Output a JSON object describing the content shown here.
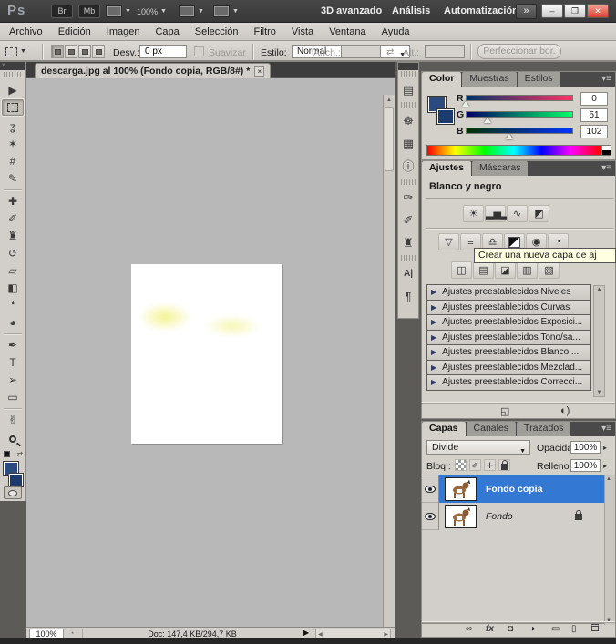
{
  "titlebar": {
    "logo": "Ps",
    "buttons": [
      "Br",
      "Mb"
    ],
    "zoom": "100%",
    "workspaces": [
      "3D avanzado",
      "Análisis",
      "Automatización"
    ],
    "more": "»",
    "window_buttons": [
      "–",
      "❐",
      "✕"
    ]
  },
  "menubar": {
    "items": [
      "Archivo",
      "Edición",
      "Imagen",
      "Capa",
      "Selección",
      "Filtro",
      "Vista",
      "Ventana",
      "Ayuda"
    ]
  },
  "optionsbar": {
    "feather_label": "Desv.:",
    "feather_value": "0 px",
    "antialias_label": "Suavizar",
    "style_label": "Estilo:",
    "style_value": "Normal",
    "width_label": "Anch.:",
    "swap_icon": "⇄",
    "height_label": "Alt.:",
    "refine_button": "Perfeccionar bor."
  },
  "toolbar": {
    "collapse": "»",
    "tools": [
      {
        "name": "move",
        "glyph": "▶"
      },
      {
        "name": "lasso",
        "glyph": "ʓ"
      },
      {
        "name": "quick-selection",
        "glyph": "✶"
      },
      {
        "name": "crop",
        "glyph": "#"
      },
      {
        "name": "eyedropper",
        "glyph": "✎"
      },
      {
        "name": "spot-healing",
        "glyph": "✚"
      },
      {
        "name": "brush",
        "glyph": "✐"
      },
      {
        "name": "clone-stamp",
        "glyph": "♜"
      },
      {
        "name": "history-brush",
        "glyph": "↺"
      },
      {
        "name": "eraser",
        "glyph": "▱"
      },
      {
        "name": "gradient",
        "glyph": "◧"
      },
      {
        "name": "blur",
        "glyph": "❛"
      },
      {
        "name": "dodge-burn",
        "glyph": "◕"
      },
      {
        "name": "pen",
        "glyph": "✒"
      },
      {
        "name": "type",
        "glyph": "T"
      },
      {
        "name": "path-selection",
        "glyph": "➢"
      },
      {
        "name": "shape",
        "glyph": "▭"
      },
      {
        "name": "hand",
        "glyph": "✌"
      }
    ]
  },
  "document": {
    "tab": "descarga.jpg al 100% (Fondo copia, RGB/8#) *",
    "close": "×",
    "status_zoom": "100%",
    "status_doc": "Doc: 147,4 KB/294,7 KB"
  },
  "icon_dock": [
    {
      "name": "history",
      "glyph": "▤"
    },
    {
      "name": "navigator",
      "glyph": "☸"
    },
    {
      "name": "histogram",
      "glyph": "▦"
    },
    {
      "name": "info",
      "glyph": "ⓘ"
    },
    {
      "name": "brush-presets",
      "glyph": "✑"
    },
    {
      "name": "brushes",
      "glyph": "✐"
    },
    {
      "name": "clone-source",
      "glyph": "♜"
    },
    {
      "name": "character",
      "glyph": "A|"
    },
    {
      "name": "paragraph",
      "glyph": "¶"
    }
  ],
  "color_panel": {
    "tabs": [
      "Color",
      "Muestras",
      "Estilos"
    ],
    "menu_icon": "▾≡",
    "channels": [
      {
        "label": "R",
        "value": "0",
        "slider_style": "left:6px"
      },
      {
        "label": "G",
        "value": "51",
        "slider_style": "left:30px"
      },
      {
        "label": "B",
        "value": "102",
        "slider_style": "left:54px"
      }
    ],
    "foreground": "#003366"
  },
  "adjustments_panel": {
    "tabs": [
      "Ajustes",
      "Máscaras"
    ],
    "menu_icon": "▾≡",
    "title": "Blanco y negro",
    "tooltip": "Crear una nueva capa de aj",
    "row1": [
      {
        "name": "brightness-contrast",
        "glyph": "☀"
      },
      {
        "name": "levels",
        "glyph": "▂▅▂"
      },
      {
        "name": "curves",
        "glyph": "∿"
      },
      {
        "name": "exposure",
        "glyph": "◩"
      }
    ],
    "row2": [
      {
        "name": "vibrance",
        "glyph": "▽"
      },
      {
        "name": "hue-saturation",
        "glyph": "≡"
      },
      {
        "name": "color-balance",
        "glyph": "♎"
      },
      {
        "name": "black-white",
        "glyph": ""
      },
      {
        "name": "photo-filter",
        "glyph": "◉"
      },
      {
        "name": "channel-mixer",
        "glyph": "◔"
      }
    ],
    "row3": [
      {
        "name": "invert",
        "glyph": "◫"
      },
      {
        "name": "posterize",
        "glyph": "▤"
      },
      {
        "name": "threshold",
        "glyph": "◪"
      },
      {
        "name": "gradient-map",
        "glyph": "▥"
      },
      {
        "name": "selective-color",
        "glyph": "▧"
      }
    ],
    "presets": [
      "Ajustes preestablecidos Niveles",
      "Ajustes preestablecidos Curvas",
      "Ajustes preestablecidos Exposici...",
      "Ajustes preestablecidos Tono/sa...",
      "Ajustes preestablecidos Blanco ...",
      "Ajustes preestablecidos Mezclad...",
      "Ajustes preestablecidos Correcci..."
    ],
    "expand_icon": "◱",
    "clip_icon": "◐)"
  },
  "layers_panel": {
    "tabs": [
      "Capas",
      "Canales",
      "Trazados"
    ],
    "menu_icon": "▾≡",
    "blend_mode": "Divide",
    "opacity_label": "Opacidad:",
    "opacity_value": "100%",
    "lock_label": "Bloq.:",
    "fill_label": "Relleno:",
    "fill_value": "100%",
    "layers": [
      {
        "name": "Fondo copia"
      },
      {
        "name": "Fondo"
      }
    ],
    "bottom_icons": [
      {
        "name": "link-layers",
        "glyph": "∞"
      },
      {
        "name": "layer-effects",
        "glyph": "fx"
      },
      {
        "name": "add-mask",
        "glyph": "◘"
      },
      {
        "name": "new-adjustment-layer",
        "glyph": "◑"
      },
      {
        "name": "new-group",
        "glyph": "▭"
      },
      {
        "name": "new-layer",
        "glyph": "▯"
      }
    ]
  },
  "colors": {
    "selection_blue": "#3378d2",
    "foreground_swatch": "#2a4a80",
    "background_swatch": "#1c3a6e",
    "accent_red": "#cc1111",
    "tooltip_bg": "#ffffe1"
  }
}
